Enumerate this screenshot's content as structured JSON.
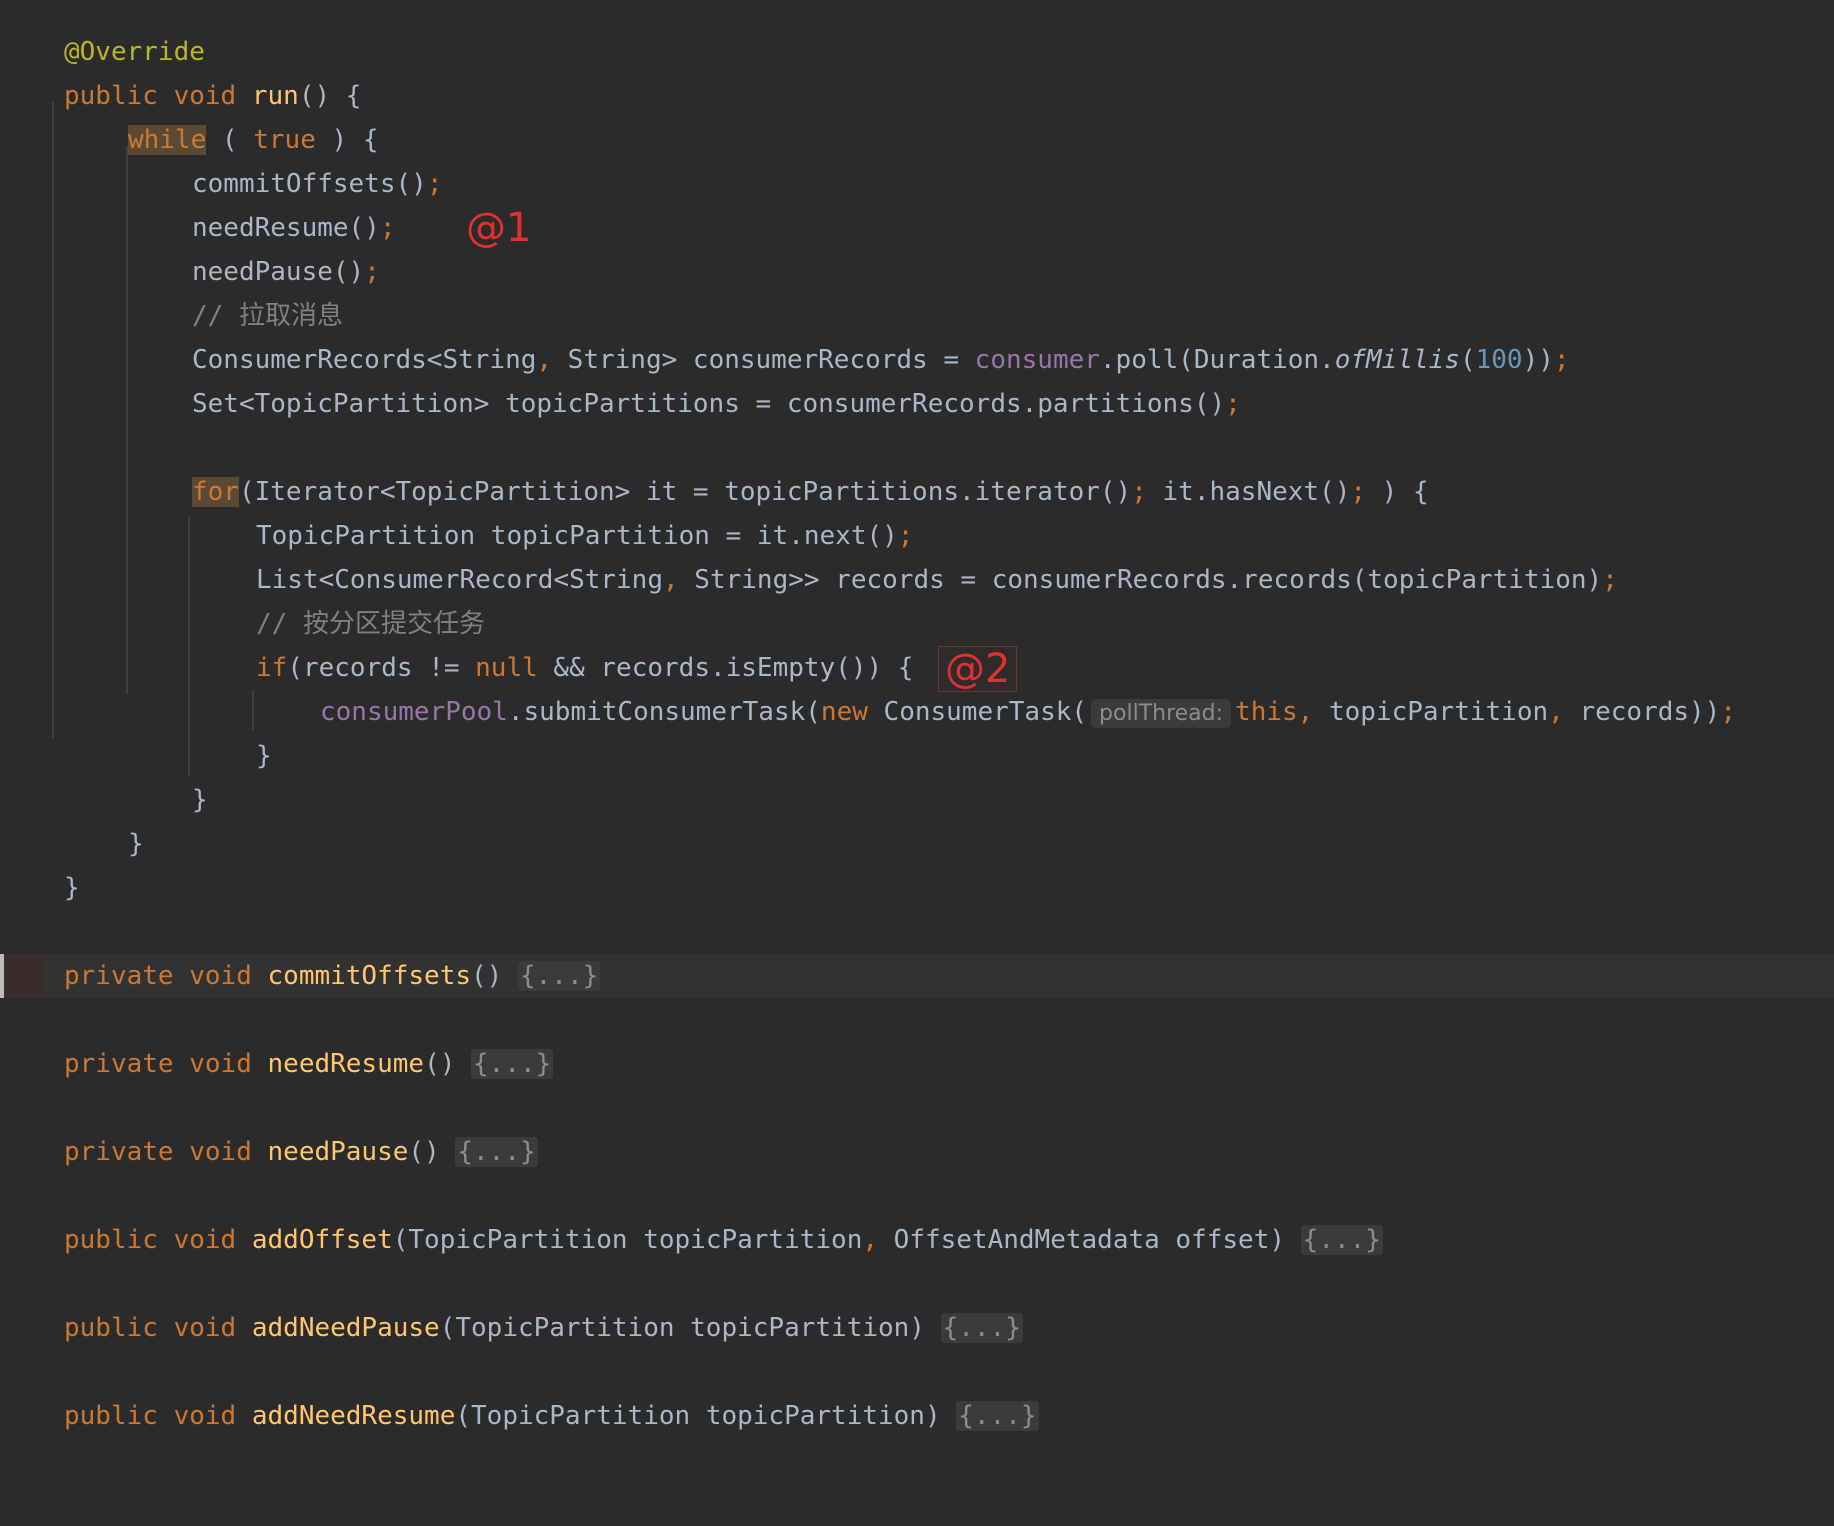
{
  "code": {
    "annotation": "@Override",
    "run_sig": {
      "public": "public",
      "void": "void",
      "name": "run",
      "rest": "() {"
    },
    "while_line": {
      "kw": "while",
      "mid": " ( ",
      "true": "true",
      "rest": " ) {"
    },
    "commit_call": {
      "text": "commitOffsets()",
      "semi": ";"
    },
    "resume_call": {
      "text": "needResume()",
      "semi": ";"
    },
    "pause_call": {
      "text": "needPause()",
      "semi": ";"
    },
    "comment_pull": {
      "slash": "// ",
      "text": "拉取消息"
    },
    "records_line": {
      "a": "ConsumerRecords<String",
      "comma": ",",
      "b": " String> consumerRecords = ",
      "field": "consumer",
      "c": ".poll(Duration.",
      "method": "ofMillis",
      "d": "(",
      "num": "100",
      "e": "))",
      "semi": ";"
    },
    "partitions_line": {
      "text": "Set<TopicPartition> topicPartitions = consumerRecords.partitions()",
      "semi": ";"
    },
    "for_line": {
      "kw": "for",
      "a": "(Iterator<TopicPartition> it = topicPartitions.iterator()",
      "semi1": ";",
      "b": " it.hasNext()",
      "semi2": ";",
      "c": " ) {"
    },
    "tp_line": {
      "text": "TopicPartition topicPartition = it.next()",
      "semi": ";"
    },
    "list_line": {
      "a": "List<ConsumerRecord<String",
      "comma": ",",
      "b": " String>> records = consumerRecords.records(topicPartition)",
      "semi": ";"
    },
    "comment_submit": {
      "slash": "// ",
      "text": "按分区提交任务"
    },
    "if_line": {
      "kw": "if",
      "a": "(records != ",
      "null": "null",
      "b": " && records.isEmpty()) {"
    },
    "submit_line": {
      "field": "consumerPool",
      "a": ".submitConsumerTask(",
      "new": "new",
      "b": " ConsumerTask(",
      "hint": "pollThread:",
      "this": "this",
      "comma1": ",",
      "c": " topicPartition",
      "comma2": ",",
      "d": " records))",
      "semi": ";"
    },
    "close_brace": "}",
    "methods": [
      {
        "vis": "private",
        "void": "void",
        "name": "commitOffsets",
        "params": "()",
        "fold": "{...}"
      },
      {
        "vis": "private",
        "void": "void",
        "name": "needResume",
        "params": "()",
        "fold": "{...}"
      },
      {
        "vis": "private",
        "void": "void",
        "name": "needPause",
        "params": "()",
        "fold": "{...}"
      },
      {
        "vis": "public",
        "void": "void",
        "name": "addOffset",
        "params_a": "(TopicPartition topicPartition",
        "comma": ",",
        "params_b": " OffsetAndMetadata offset)",
        "fold": "{...}"
      },
      {
        "vis": "public",
        "void": "void",
        "name": "addNeedPause",
        "params": "(TopicPartition topicPartition)",
        "fold": "{...}"
      },
      {
        "vis": "public",
        "void": "void",
        "name": "addNeedResume",
        "params": "(TopicPartition topicPartition)",
        "fold": "{...}"
      }
    ]
  },
  "markers": {
    "m1": "@1",
    "m2": "@2"
  },
  "colors": {
    "background": "#2b2b2b",
    "keyword": "#cc7832",
    "annotation": "#bbb529",
    "method": "#ffc66d",
    "field": "#9876aa",
    "number": "#6897bb",
    "comment": "#808080",
    "marker": "#e03030"
  }
}
